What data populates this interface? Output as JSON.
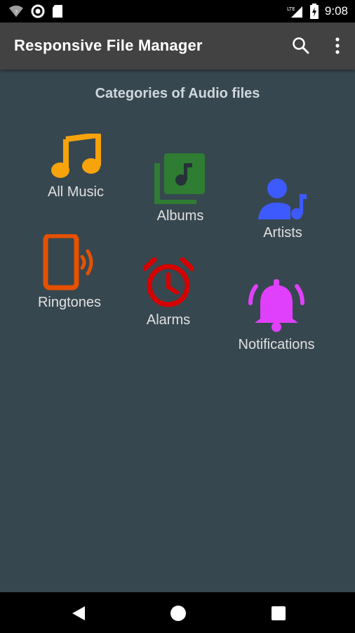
{
  "status_bar": {
    "time": "9:08",
    "network_label": "LTE",
    "icons": [
      "wifi-icon",
      "sync-icon",
      "sd-card-icon",
      "signal-icon",
      "battery-icon"
    ]
  },
  "app_bar": {
    "title": "Responsive File Manager",
    "actions": [
      "search-icon",
      "overflow-menu-icon"
    ]
  },
  "main": {
    "heading": "Categories of Audio files",
    "categories": [
      {
        "label": "All Music",
        "icon": "music-note-icon",
        "color": "#f7a30b"
      },
      {
        "label": "Albums",
        "icon": "album-library-icon",
        "color": "#2e7d32"
      },
      {
        "label": "Artists",
        "icon": "artist-icon",
        "color": "#3d5afe"
      },
      {
        "label": "Ringtones",
        "icon": "ringtone-phone-icon",
        "color": "#e65100"
      },
      {
        "label": "Alarms",
        "icon": "alarm-clock-icon",
        "color": "#d50000"
      },
      {
        "label": "Notifications",
        "icon": "bell-icon",
        "color": "#e040fb"
      }
    ]
  },
  "nav_bar": {
    "buttons": [
      "back-icon",
      "home-icon",
      "recents-icon"
    ]
  }
}
